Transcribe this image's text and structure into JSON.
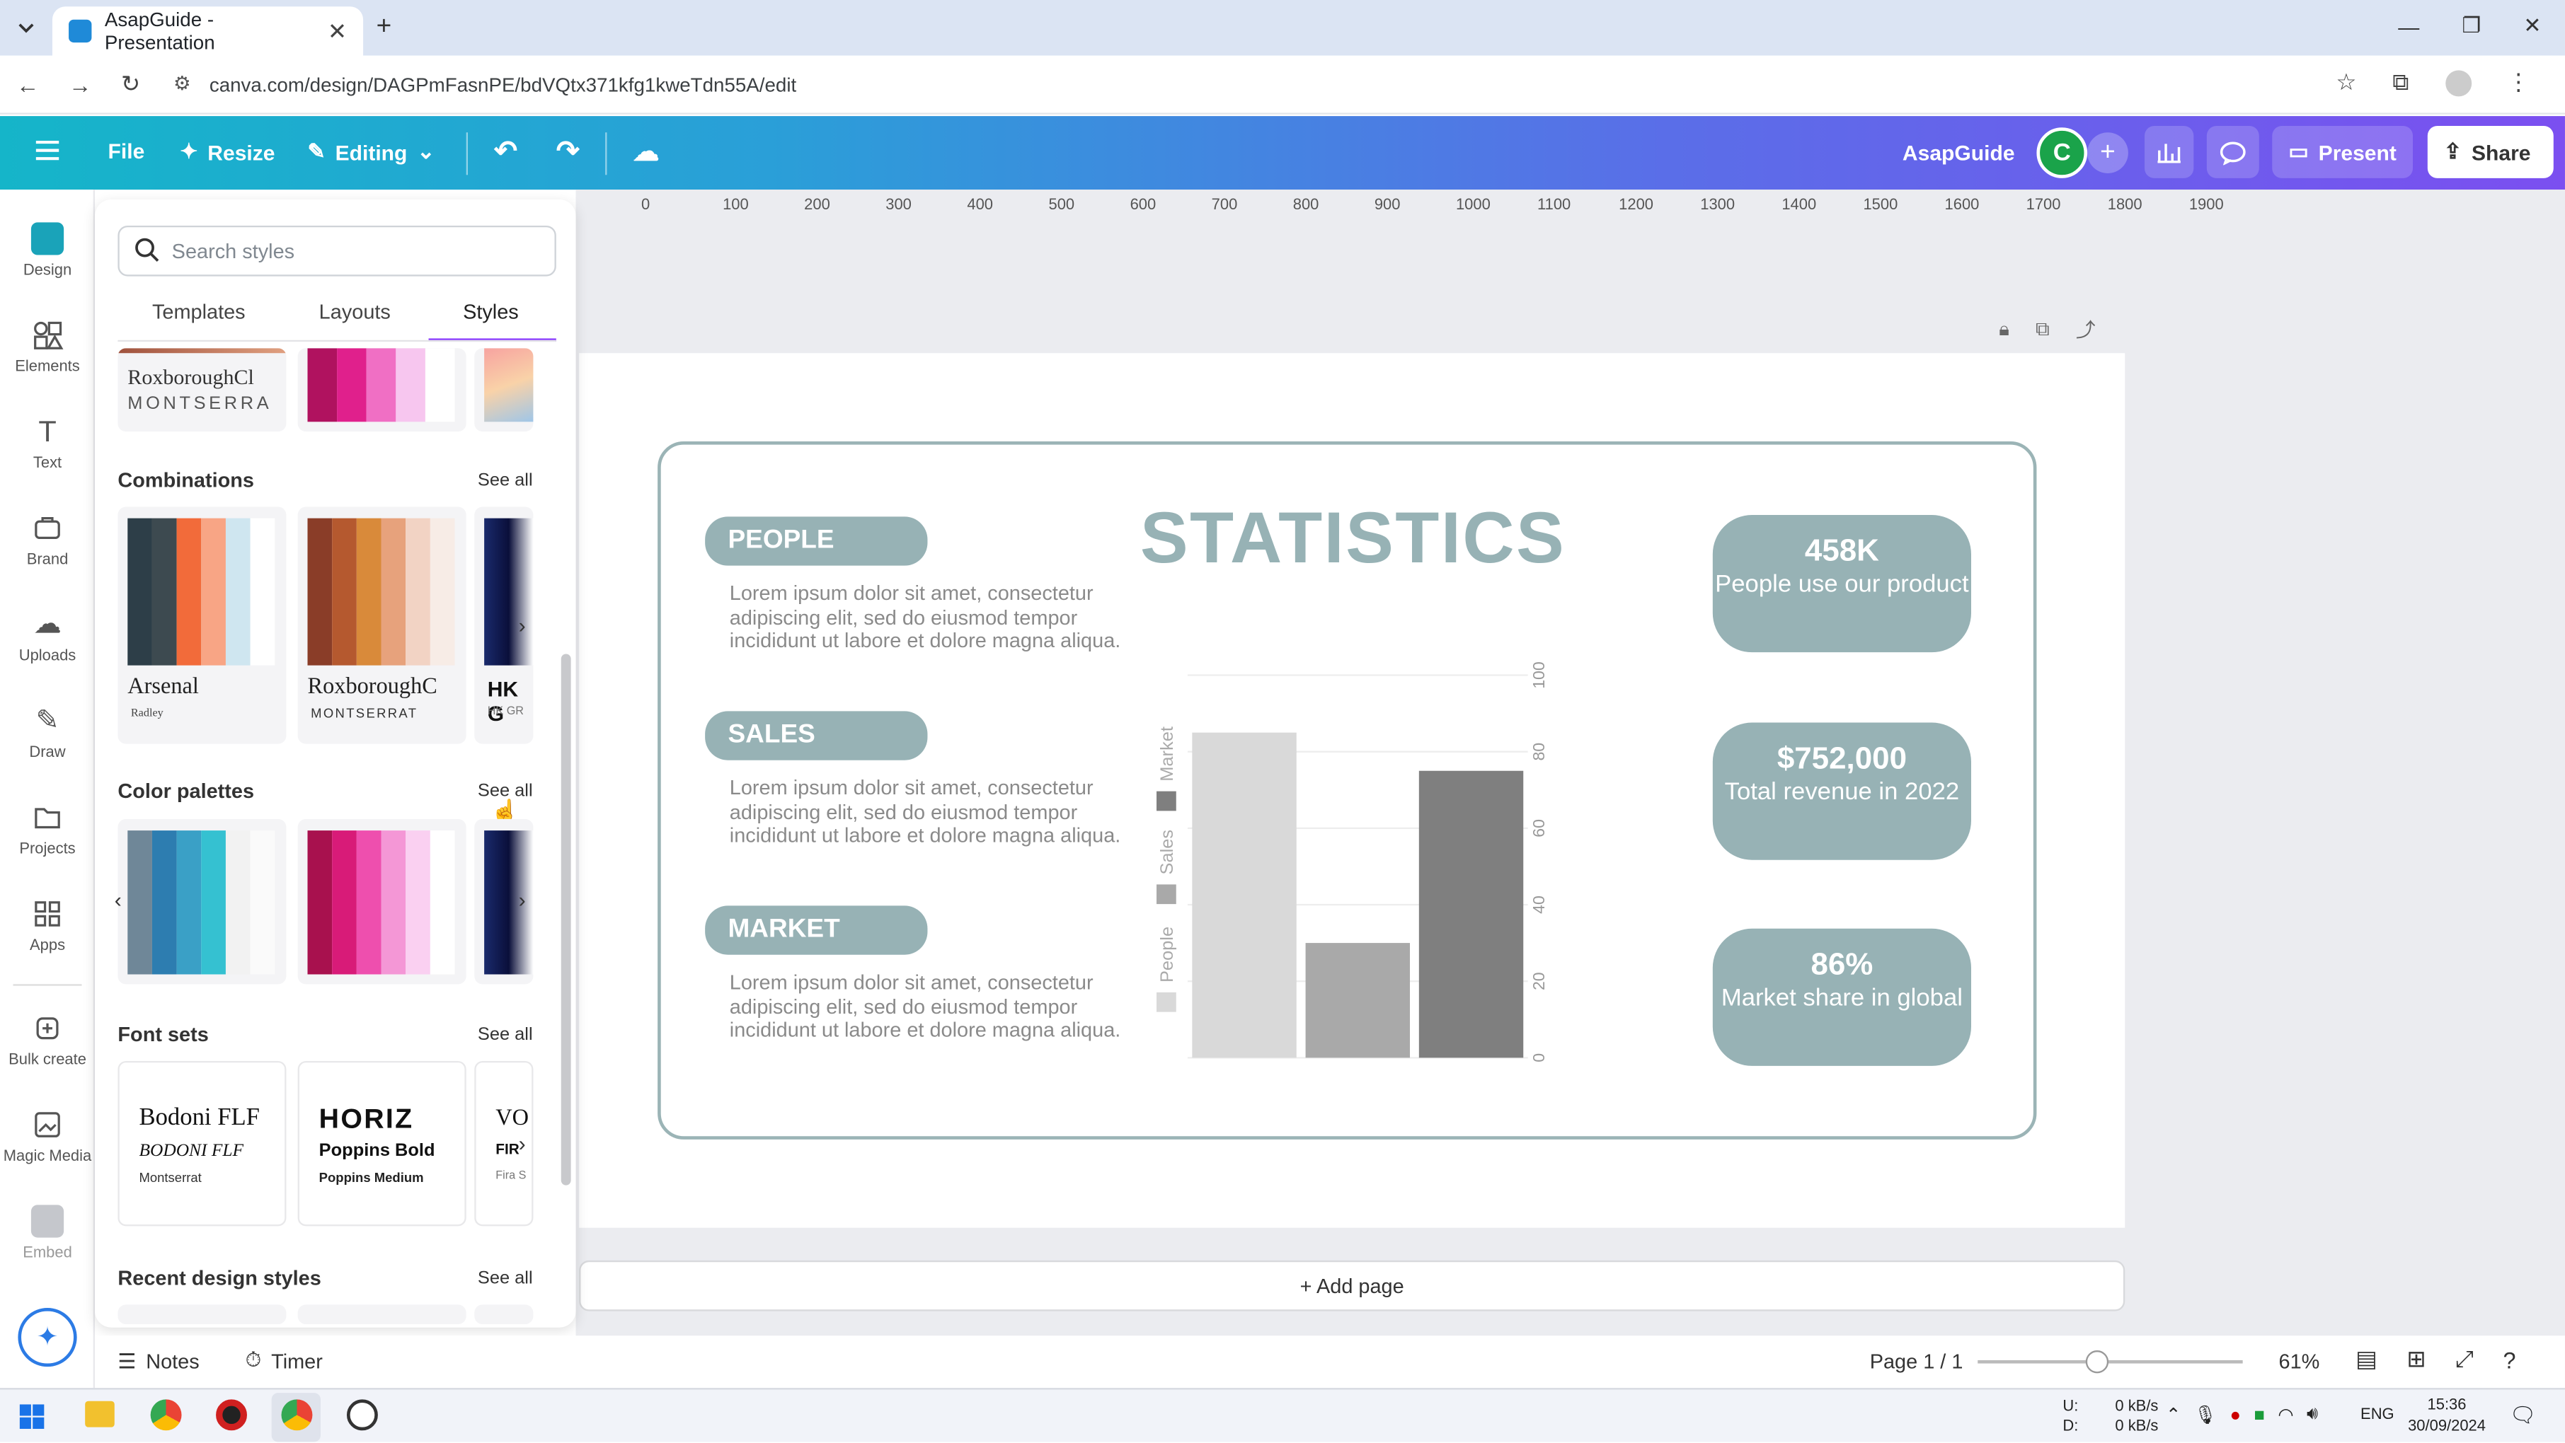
{
  "browser": {
    "tab_title": "AsapGuide - Presentation",
    "url": "canva.com/design/DAGPmFasnPE/bdVQtx371kfg1kweTdn55A/edit"
  },
  "toolbar": {
    "file": "File",
    "resize": "Resize",
    "editing": "Editing",
    "brand_name": "AsapGuide",
    "avatar_letter": "C",
    "present": "Present",
    "share": "Share"
  },
  "rail": [
    "Design",
    "Elements",
    "Text",
    "Brand",
    "Uploads",
    "Draw",
    "Projects",
    "Apps",
    "Bulk create",
    "Magic Media",
    "Embed"
  ],
  "panel": {
    "search_placeholder": "Search styles",
    "tabs": [
      "Templates",
      "Layouts",
      "Styles"
    ],
    "top_font_primary": "RoxboroughCl",
    "top_font_secondary": "MONTSERRA",
    "combinations": {
      "title": "Combinations",
      "see_all": "See all",
      "cards": [
        {
          "font1": "Arsenal",
          "font2": "Radley"
        },
        {
          "font1": "RoxboroughC",
          "font2": "MONTSERRAT"
        },
        {
          "font1": "HK G",
          "font2": "HK GR"
        }
      ]
    },
    "color_palettes": {
      "title": "Color palettes",
      "see_all": "See all"
    },
    "font_sets": {
      "title": "Font sets",
      "see_all": "See all",
      "cards": [
        {
          "a": "Bodoni FLF",
          "b": "BODONI FLF",
          "c": "Montserrat"
        },
        {
          "a": "HORIZ",
          "b": "Poppins Bold",
          "c": "Poppins Medium"
        },
        {
          "a": "VO",
          "b": "FIR",
          "c": "Fira S"
        }
      ]
    },
    "recent": {
      "title": "Recent design styles",
      "see_all": "See all"
    }
  },
  "ruler_ticks": [
    "0",
    "100",
    "200",
    "300",
    "400",
    "500",
    "600",
    "700",
    "800",
    "900",
    "1000",
    "1100",
    "1200",
    "1300",
    "1400",
    "1500",
    "1600",
    "1700",
    "1800",
    "1900"
  ],
  "slide": {
    "title": "STATISTICS",
    "sections": [
      {
        "label": "PEOPLE",
        "text": "Lorem ipsum dolor sit amet, consectetur adipiscing elit, sed do eiusmod tempor incididunt ut labore et dolore magna aliqua."
      },
      {
        "label": "SALES",
        "text": "Lorem ipsum dolor sit amet, consectetur adipiscing elit, sed do eiusmod tempor incididunt ut labore et dolore magna aliqua."
      },
      {
        "label": "MARKET",
        "text": "Lorem ipsum dolor sit amet, consectetur adipiscing elit, sed do eiusmod tempor incididunt ut labore et dolore magna aliqua."
      }
    ],
    "stats": [
      {
        "value": "458K",
        "label": "People use our product"
      },
      {
        "value": "$752,000",
        "label": "Total revenue in 2022"
      },
      {
        "value": "86%",
        "label": "Market share in global"
      }
    ],
    "add_page": "+ Add page"
  },
  "chart_data": {
    "type": "bar",
    "categories": [
      "People",
      "Sales",
      "Market"
    ],
    "values": [
      85,
      30,
      75
    ],
    "colors": [
      "#d9d9d9",
      "#a9a9a9",
      "#7f7f7f"
    ],
    "y_ticks": [
      "0",
      "20",
      "40",
      "60",
      "80",
      "100"
    ],
    "ylim": [
      0,
      100
    ],
    "legend": [
      "Market",
      "Sales",
      "People"
    ],
    "legend_position": "left-vertical",
    "grid": true
  },
  "bottom": {
    "notes": "Notes",
    "timer": "Timer",
    "page": "Page 1 / 1",
    "zoom": "61%"
  },
  "taskbar": {
    "net_up_label": "U:",
    "net_down_label": "D:",
    "net_up": "0 kB/s",
    "net_down": "0 kB/s",
    "lang": "ENG",
    "time": "15:36",
    "date": "30/09/2024"
  },
  "colors": {
    "accent_teal": "#97b2b5",
    "toolbar_start": "#15b5c9",
    "toolbar_end": "#7b4ff0"
  }
}
